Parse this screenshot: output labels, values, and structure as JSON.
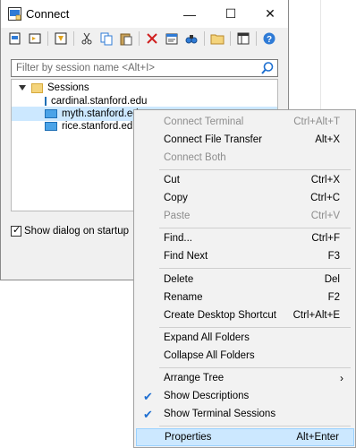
{
  "window": {
    "title": "Connect",
    "minimize_glyph": "—",
    "maximize_glyph": "☐",
    "close_glyph": "✕"
  },
  "filter": {
    "placeholder": "Filter by session name <Alt+I>"
  },
  "tree": {
    "root_label": "Sessions",
    "items": [
      {
        "label": "cardinal.stanford.edu",
        "selected": false
      },
      {
        "label": "myth.stanford.edu",
        "selected": true
      },
      {
        "label": "rice.stanford.edu",
        "selected": false
      }
    ]
  },
  "startup_checkbox": {
    "label": "Show dialog on startup",
    "checked": true
  },
  "toolbar_icons": [
    "new-session-icon",
    "quick-connect-icon",
    "import-icon",
    "cut-icon",
    "copy-icon",
    "paste-icon",
    "delete-icon",
    "properties-icon",
    "find-icon",
    "new-folder-icon",
    "layout-icon",
    "help-icon"
  ],
  "context_menu": {
    "connect_terminal": {
      "label": "Connect Terminal",
      "shortcut": "Ctrl+Alt+T"
    },
    "connect_file_transfer": {
      "label": "Connect File Transfer",
      "shortcut": "Alt+X"
    },
    "connect_both": {
      "label": "Connect Both"
    },
    "cut": {
      "label": "Cut",
      "shortcut": "Ctrl+X"
    },
    "copy": {
      "label": "Copy",
      "shortcut": "Ctrl+C"
    },
    "paste": {
      "label": "Paste",
      "shortcut": "Ctrl+V"
    },
    "find": {
      "label": "Find...",
      "shortcut": "Ctrl+F"
    },
    "find_next": {
      "label": "Find Next",
      "shortcut": "F3"
    },
    "delete": {
      "label": "Delete",
      "shortcut": "Del"
    },
    "rename": {
      "label": "Rename",
      "shortcut": "F2"
    },
    "create_shortcut": {
      "label": "Create Desktop Shortcut",
      "shortcut": "Ctrl+Alt+E"
    },
    "expand_all": {
      "label": "Expand All Folders"
    },
    "collapse_all": {
      "label": "Collapse All Folders"
    },
    "arrange_tree": {
      "label": "Arrange Tree",
      "arrow": "›"
    },
    "show_descriptions": {
      "label": "Show Descriptions",
      "checked": true,
      "check_glyph": "✔"
    },
    "show_terminal_sessions": {
      "label": "Show Terminal Sessions",
      "checked": true,
      "check_glyph": "✔"
    },
    "properties": {
      "label": "Properties",
      "shortcut": "Alt+Enter"
    }
  }
}
